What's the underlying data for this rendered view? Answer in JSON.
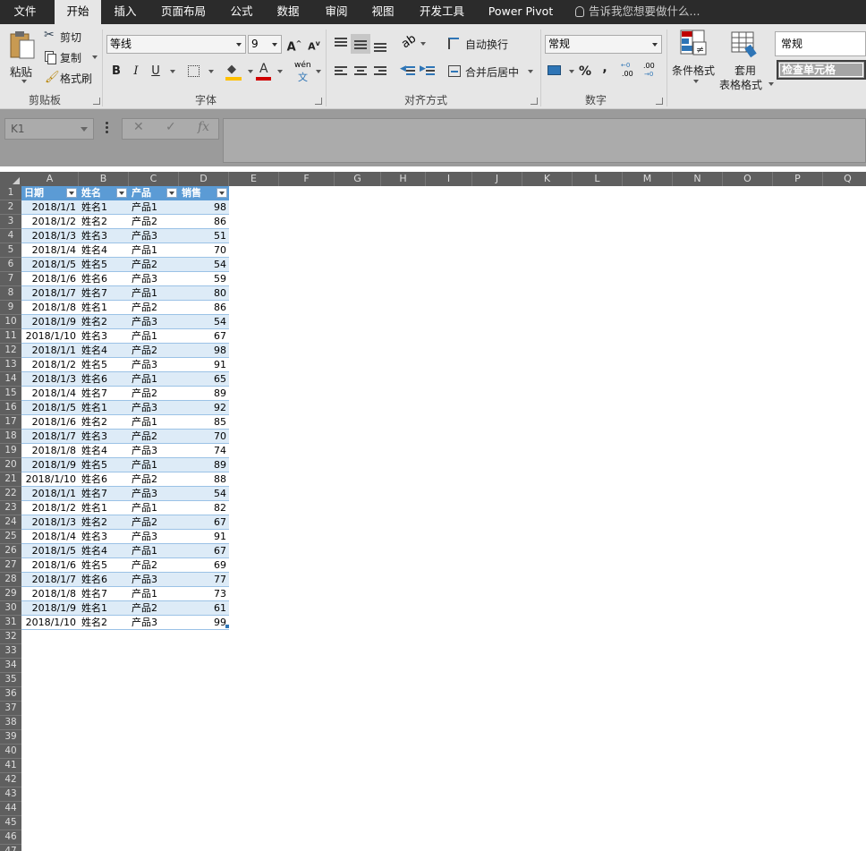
{
  "menu": {
    "tabs": [
      "文件",
      "开始",
      "插入",
      "页面布局",
      "公式",
      "数据",
      "审阅",
      "视图",
      "开发工具",
      "Power Pivot"
    ],
    "active": "开始",
    "tell_me": "告诉我您想要做什么..."
  },
  "ribbon": {
    "clipboard": {
      "paste": "粘贴",
      "cut": "剪切",
      "copy": "复制",
      "format_painter": "格式刷",
      "label": "剪贴板"
    },
    "font": {
      "name": "等线",
      "size": "9",
      "bold": "B",
      "italic": "I",
      "underline": "U",
      "phonetic": "wén",
      "grow": "A",
      "shrink": "A",
      "label": "字体"
    },
    "alignment": {
      "wrap_text": "自动换行",
      "merge_center": "合并后居中",
      "label": "对齐方式"
    },
    "number": {
      "format": "常规",
      "percent": "%",
      "comma": ",",
      "inc_decimal": ".00",
      "dec_decimal": ".00",
      "label": "数字"
    },
    "styles": {
      "conditional": "条件格式",
      "format_table_1": "套用",
      "format_table_2": "表格格式",
      "style_normal": "常规",
      "style_check": "检查单元格"
    }
  },
  "formula_bar": {
    "name_box": "K1",
    "fx": "fx",
    "value": ""
  },
  "sheet": {
    "columns": [
      "A",
      "B",
      "C",
      "D",
      "E",
      "F",
      "G",
      "H",
      "I",
      "J",
      "K",
      "L",
      "M",
      "N",
      "O",
      "P",
      "Q"
    ],
    "row_count": 47,
    "headers": [
      "日期",
      "姓名",
      "产品",
      "销售"
    ],
    "rows": [
      [
        "2018/1/1",
        "姓名1",
        "产品1",
        "98"
      ],
      [
        "2018/1/2",
        "姓名2",
        "产品2",
        "86"
      ],
      [
        "2018/1/3",
        "姓名3",
        "产品3",
        "51"
      ],
      [
        "2018/1/4",
        "姓名4",
        "产品1",
        "70"
      ],
      [
        "2018/1/5",
        "姓名5",
        "产品2",
        "54"
      ],
      [
        "2018/1/6",
        "姓名6",
        "产品3",
        "59"
      ],
      [
        "2018/1/7",
        "姓名7",
        "产品1",
        "80"
      ],
      [
        "2018/1/8",
        "姓名1",
        "产品2",
        "86"
      ],
      [
        "2018/1/9",
        "姓名2",
        "产品3",
        "54"
      ],
      [
        "2018/1/10",
        "姓名3",
        "产品1",
        "67"
      ],
      [
        "2018/1/1",
        "姓名4",
        "产品2",
        "98"
      ],
      [
        "2018/1/2",
        "姓名5",
        "产品3",
        "91"
      ],
      [
        "2018/1/3",
        "姓名6",
        "产品1",
        "65"
      ],
      [
        "2018/1/4",
        "姓名7",
        "产品2",
        "89"
      ],
      [
        "2018/1/5",
        "姓名1",
        "产品3",
        "92"
      ],
      [
        "2018/1/6",
        "姓名2",
        "产品1",
        "85"
      ],
      [
        "2018/1/7",
        "姓名3",
        "产品2",
        "70"
      ],
      [
        "2018/1/8",
        "姓名4",
        "产品3",
        "74"
      ],
      [
        "2018/1/9",
        "姓名5",
        "产品1",
        "89"
      ],
      [
        "2018/1/10",
        "姓名6",
        "产品2",
        "88"
      ],
      [
        "2018/1/1",
        "姓名7",
        "产品3",
        "54"
      ],
      [
        "2018/1/2",
        "姓名1",
        "产品1",
        "82"
      ],
      [
        "2018/1/3",
        "姓名2",
        "产品2",
        "67"
      ],
      [
        "2018/1/4",
        "姓名3",
        "产品3",
        "91"
      ],
      [
        "2018/1/5",
        "姓名4",
        "产品1",
        "67"
      ],
      [
        "2018/1/6",
        "姓名5",
        "产品2",
        "69"
      ],
      [
        "2018/1/7",
        "姓名6",
        "产品3",
        "77"
      ],
      [
        "2018/1/8",
        "姓名7",
        "产品1",
        "73"
      ],
      [
        "2018/1/9",
        "姓名1",
        "产品2",
        "61"
      ],
      [
        "2018/1/10",
        "姓名2",
        "产品3",
        "99"
      ]
    ]
  }
}
